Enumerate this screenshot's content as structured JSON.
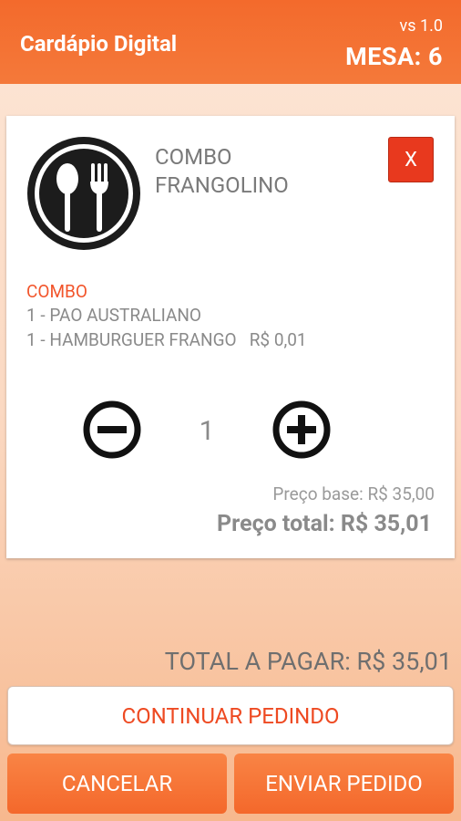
{
  "header": {
    "title": "Cardápio Digital",
    "version": "vs 1.0",
    "mesa": "MESA: 6"
  },
  "item": {
    "icon": "utensils-icon",
    "name_line1": "COMBO",
    "name_line2": "FRANGOLINO",
    "close_label": "X",
    "combo_label": "COMBO",
    "combo_lines": [
      "1 - PAO AUSTRALIANO",
      "1 - HAMBURGUER FRANGO   R$ 0,01"
    ],
    "quantity": "1",
    "preco_base": "Preço base: R$ 35,00",
    "preco_total": "Preço total: R$ 35,01"
  },
  "footer": {
    "total_pagar": "TOTAL A PAGAR: R$ 35,01",
    "continuar_label": "CONTINUAR PEDINDO",
    "cancelar_label": "CANCELAR",
    "enviar_label": "ENVIAR PEDIDO"
  },
  "colors": {
    "accent": "#f36a2c",
    "close_button": "#e8391e",
    "combo_label": "#f2542a"
  }
}
